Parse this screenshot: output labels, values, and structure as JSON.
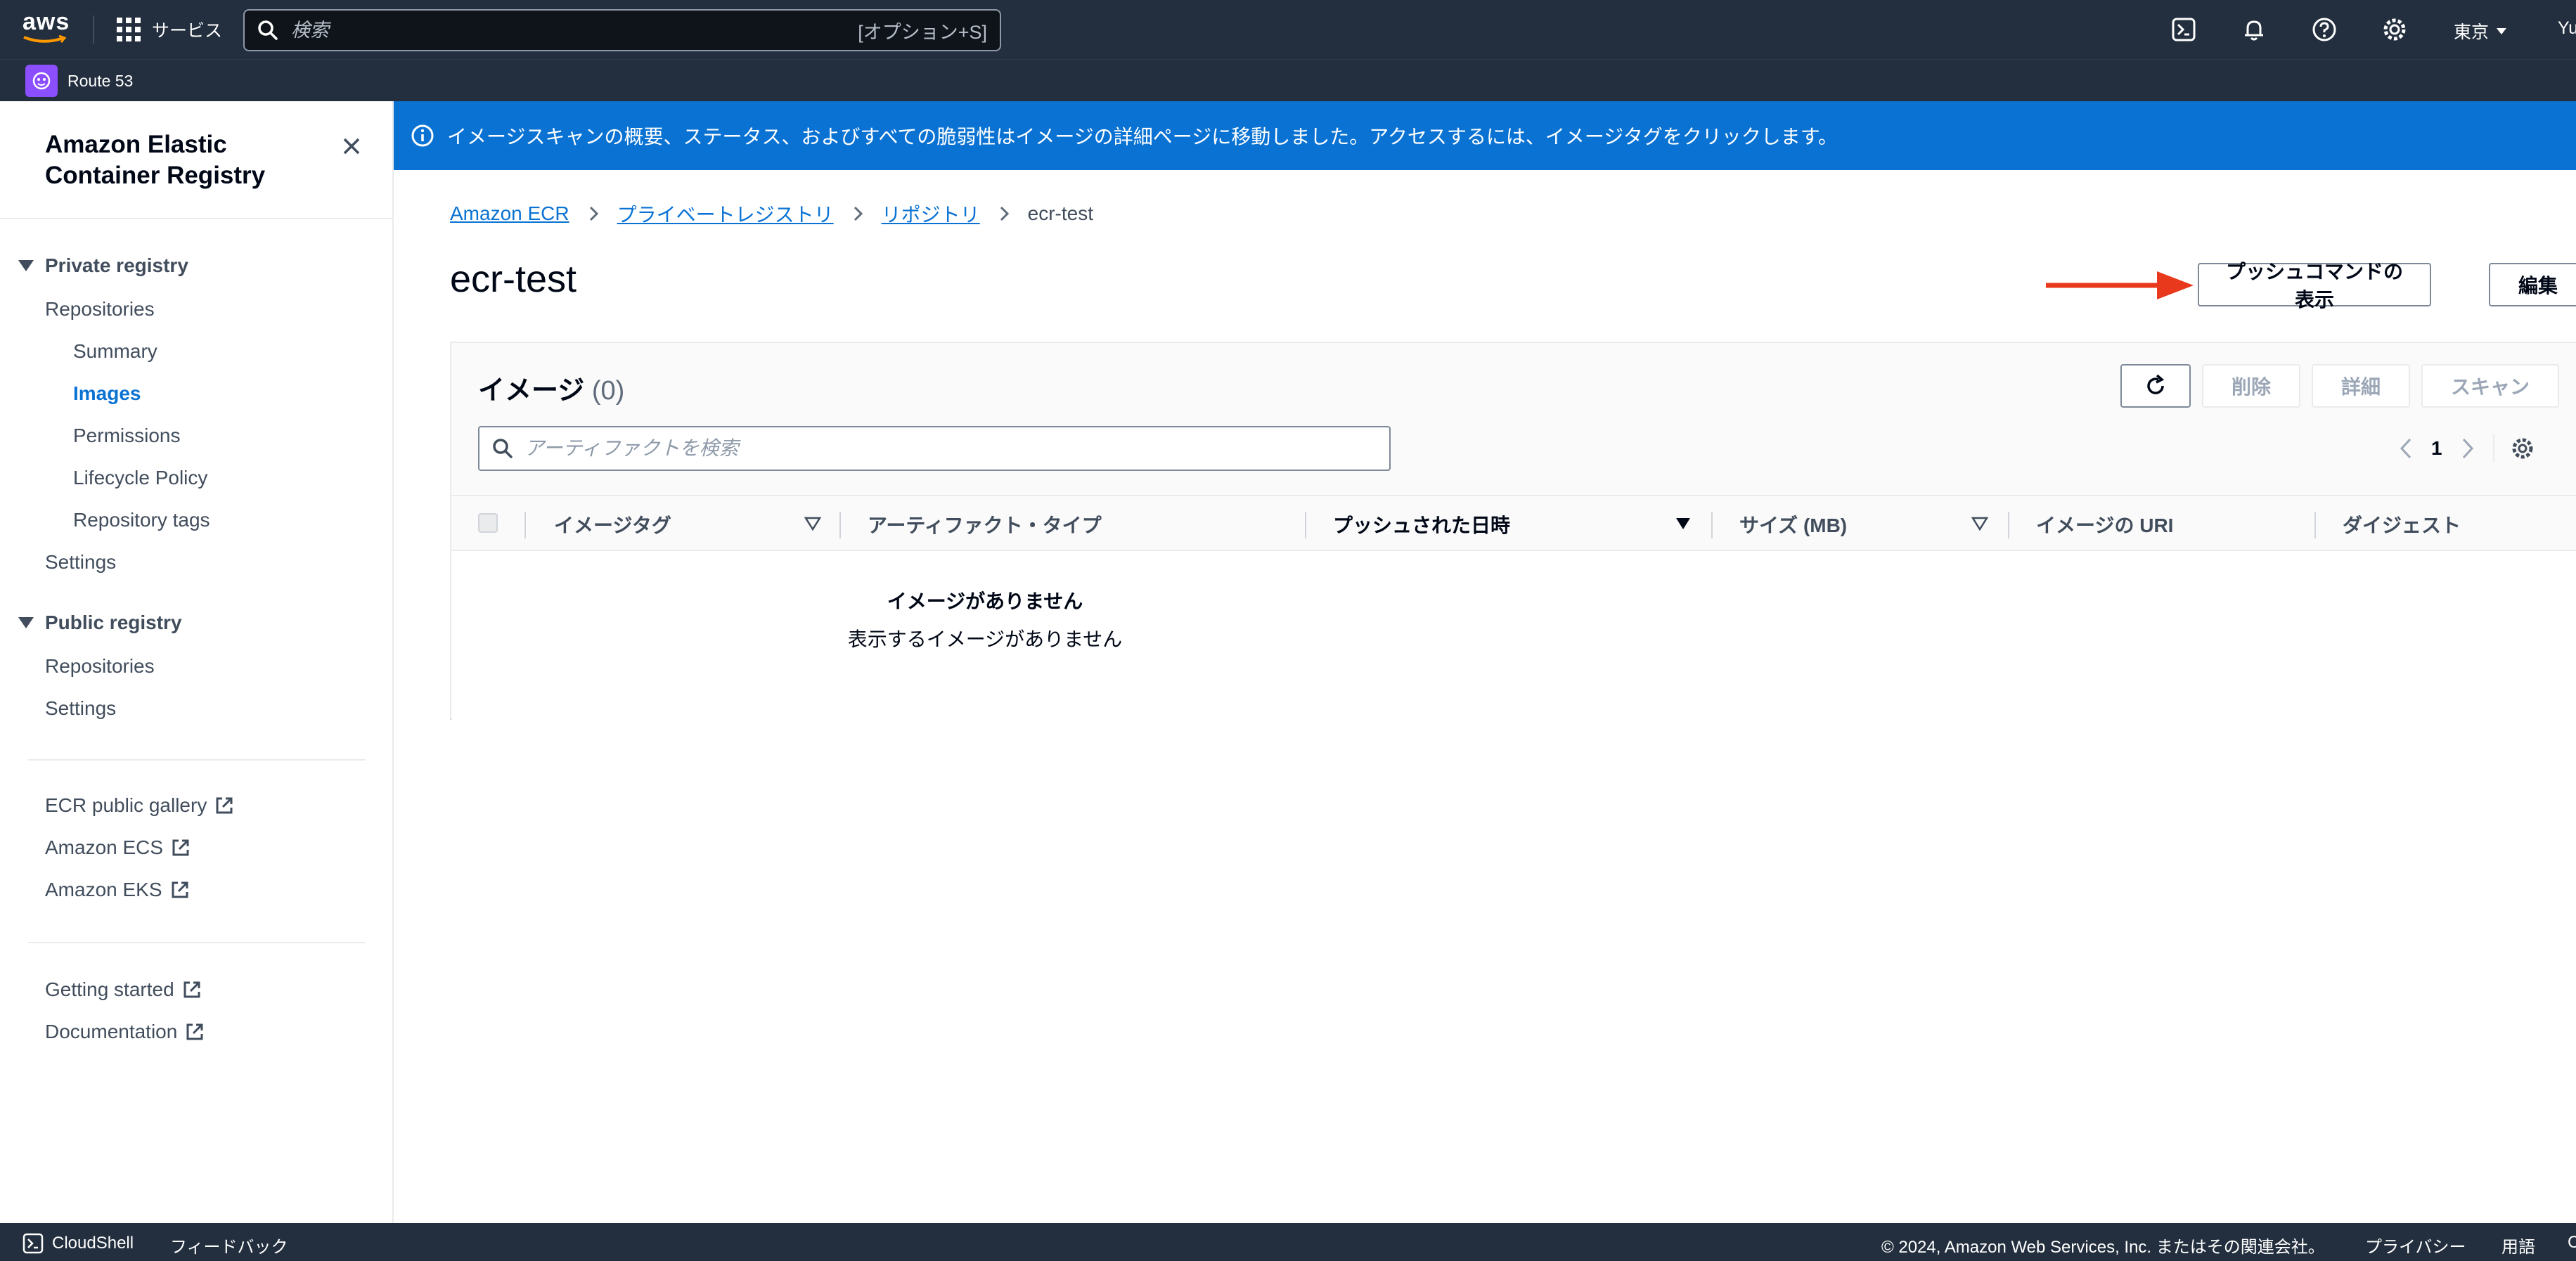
{
  "topnav": {
    "logo": "aws",
    "services_label": "サービス",
    "search_placeholder": "検索",
    "search_shortcut": "[オプション+S]",
    "region": "東京",
    "user": "Yu",
    "icons": [
      "cloudshell-icon",
      "bell-icon",
      "help-icon",
      "gear-icon"
    ]
  },
  "favorites": {
    "route53": "Route 53"
  },
  "sidebar": {
    "title": "Amazon Elastic Container Registry",
    "private_registry": "Private registry",
    "private_items": {
      "repositories": "Repositories",
      "summary": "Summary",
      "images": "Images",
      "permissions": "Permissions",
      "lifecycle": "Lifecycle Policy",
      "repo_tags": "Repository tags",
      "settings": "Settings"
    },
    "public_registry": "Public registry",
    "public_items": {
      "repositories": "Repositories",
      "settings": "Settings"
    },
    "external_links": {
      "gallery": "ECR public gallery",
      "ecs": "Amazon ECS",
      "eks": "Amazon EKS"
    },
    "help_links": {
      "getting_started": "Getting started",
      "documentation": "Documentation"
    }
  },
  "banner": {
    "message": "イメージスキャンの概要、ステータス、およびすべての脆弱性はイメージの詳細ページに移動しました。アクセスするには、イメージタグをクリックします。"
  },
  "breadcrumb": {
    "ecr": "Amazon ECR",
    "private": "プライベートレジストリ",
    "repos": "リポジトリ",
    "current": "ecr-test"
  },
  "page": {
    "title": "ecr-test",
    "push_commands_button": "プッシュコマンドの表示",
    "edit_button": "編集"
  },
  "images_panel": {
    "title": "イメージ",
    "count": "(0)",
    "delete_button": "削除",
    "details_button": "詳細",
    "scan_button": "スキャン",
    "search_placeholder": "アーティファクトを検索",
    "page_number": "1",
    "columns": {
      "tag": "イメージタグ",
      "artifact_type": "アーティファクト・タイプ",
      "pushed_at": "プッシュされた日時",
      "size": "サイズ (MB)",
      "uri": "イメージの URI",
      "digest": "ダイジェスト"
    },
    "empty_title": "イメージがありません",
    "empty_subtitle": "表示するイメージがありません"
  },
  "footer": {
    "cloudshell": "CloudShell",
    "feedback": "フィードバック",
    "copyright": "© 2024, Amazon Web Services, Inc. またはその関連会社。",
    "privacy": "プライバシー",
    "terms": "用語",
    "cookie": "C"
  },
  "colors": {
    "nav_bg": "#232f3e",
    "accent": "#0972d3",
    "arrow": "#e8391c",
    "route53": "#8c4fff"
  }
}
